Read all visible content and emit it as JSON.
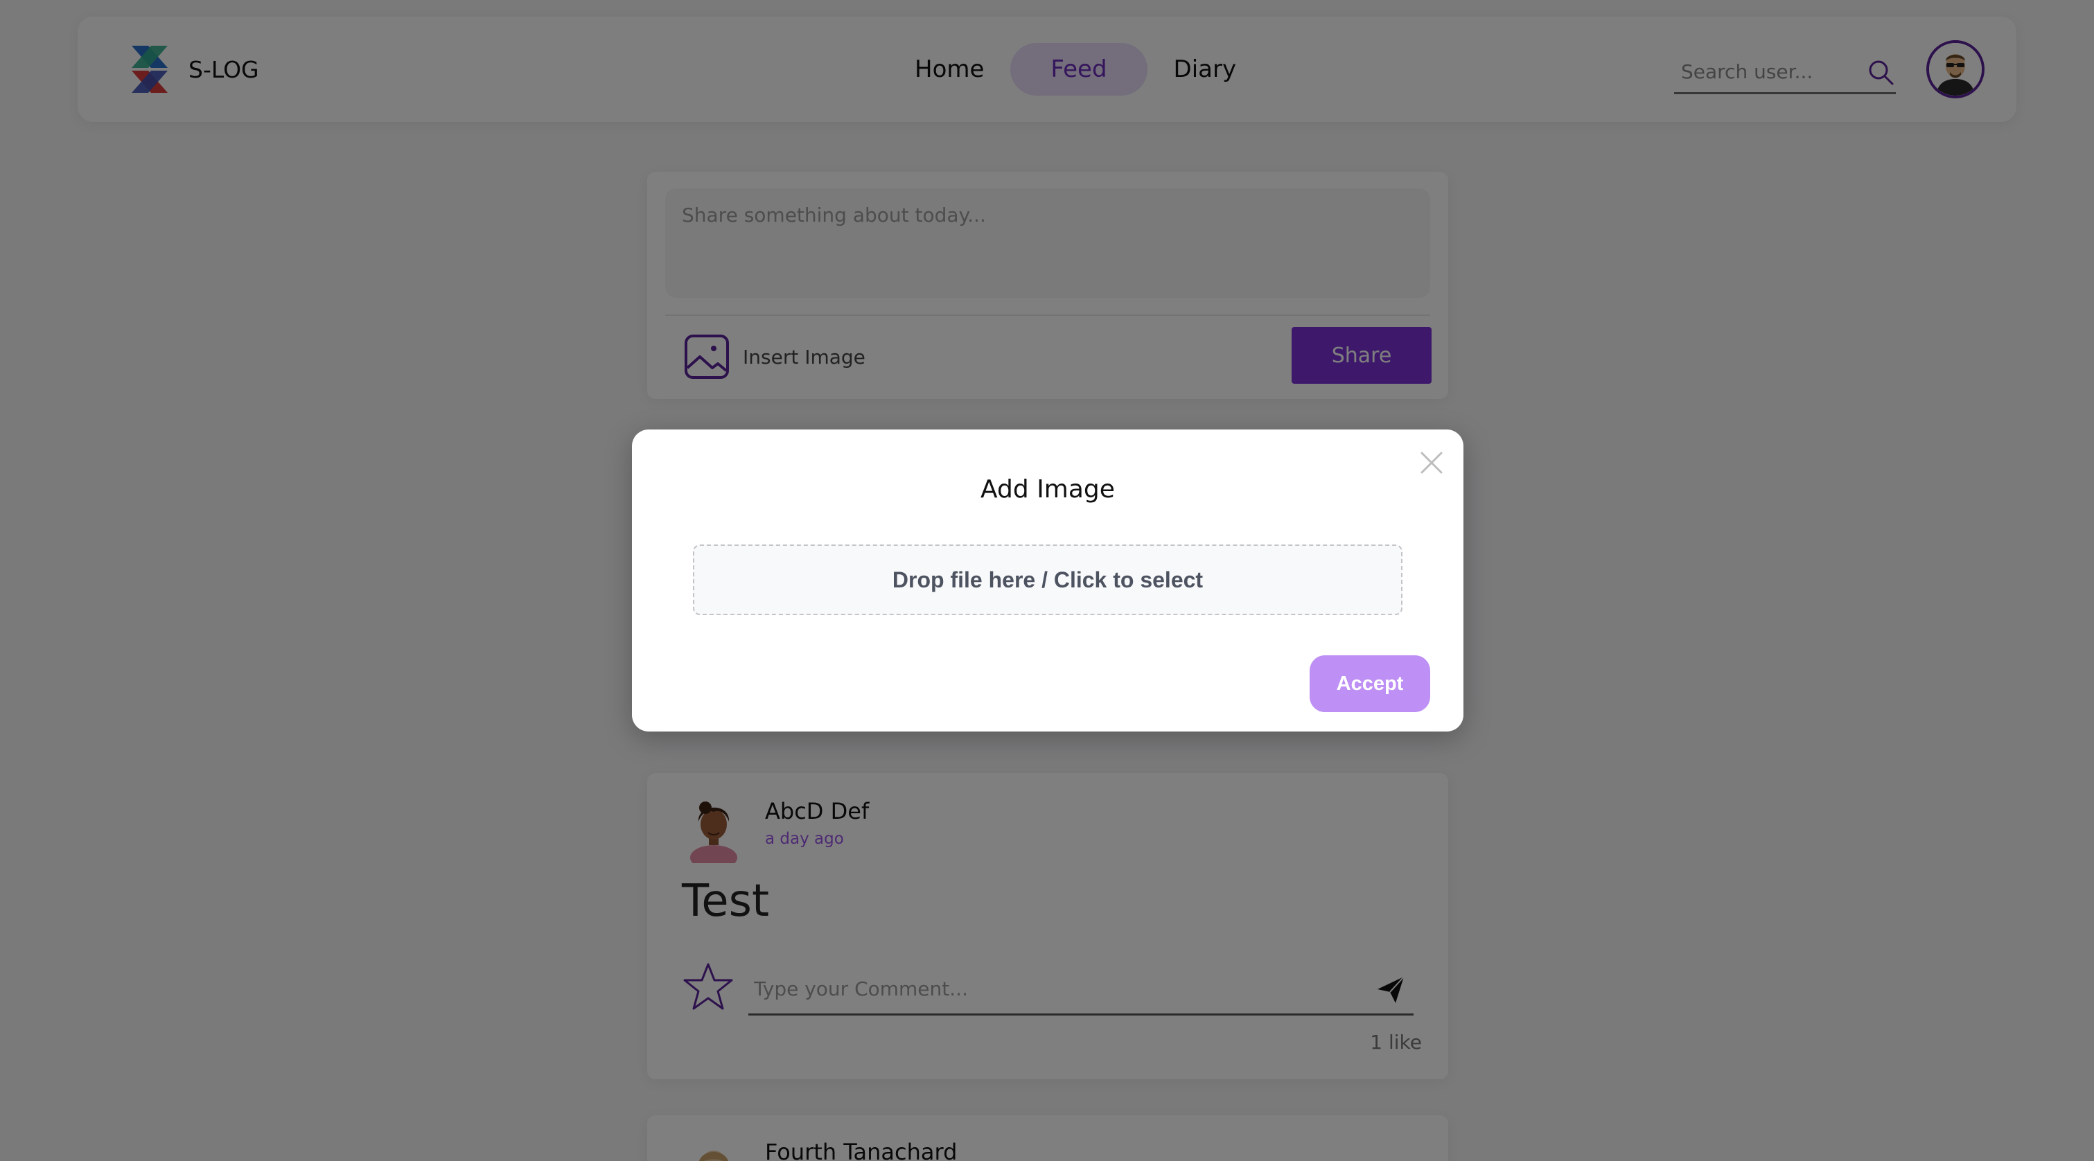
{
  "navbar": {
    "brand": "S-LOG",
    "links": [
      {
        "label": "Home",
        "active": false
      },
      {
        "label": "Feed",
        "active": true
      },
      {
        "label": "Diary",
        "active": false
      }
    ],
    "search_placeholder": "Search user...",
    "icons": {
      "search": "search-icon",
      "avatar": "user-avatar"
    }
  },
  "composer": {
    "placeholder": "Share something about today...",
    "insert_label": "Insert Image",
    "share_label": "Share"
  },
  "posts": [
    {
      "author": "AbcD Def",
      "time": "a day ago",
      "body": "Test",
      "comment_placeholder": "Type your Comment...",
      "likes": "1 like"
    },
    {
      "author": "Fourth Tanachard"
    }
  ],
  "modal": {
    "title": "Add Image",
    "dropzone_text": "Drop file here / Click to select",
    "accept_label": "Accept"
  },
  "colors": {
    "accent": "#7d33d6",
    "accent_light": "#e6daf8",
    "accept_button": "#be8ff4",
    "overlay": "rgba(0,0,0,0.5)"
  }
}
